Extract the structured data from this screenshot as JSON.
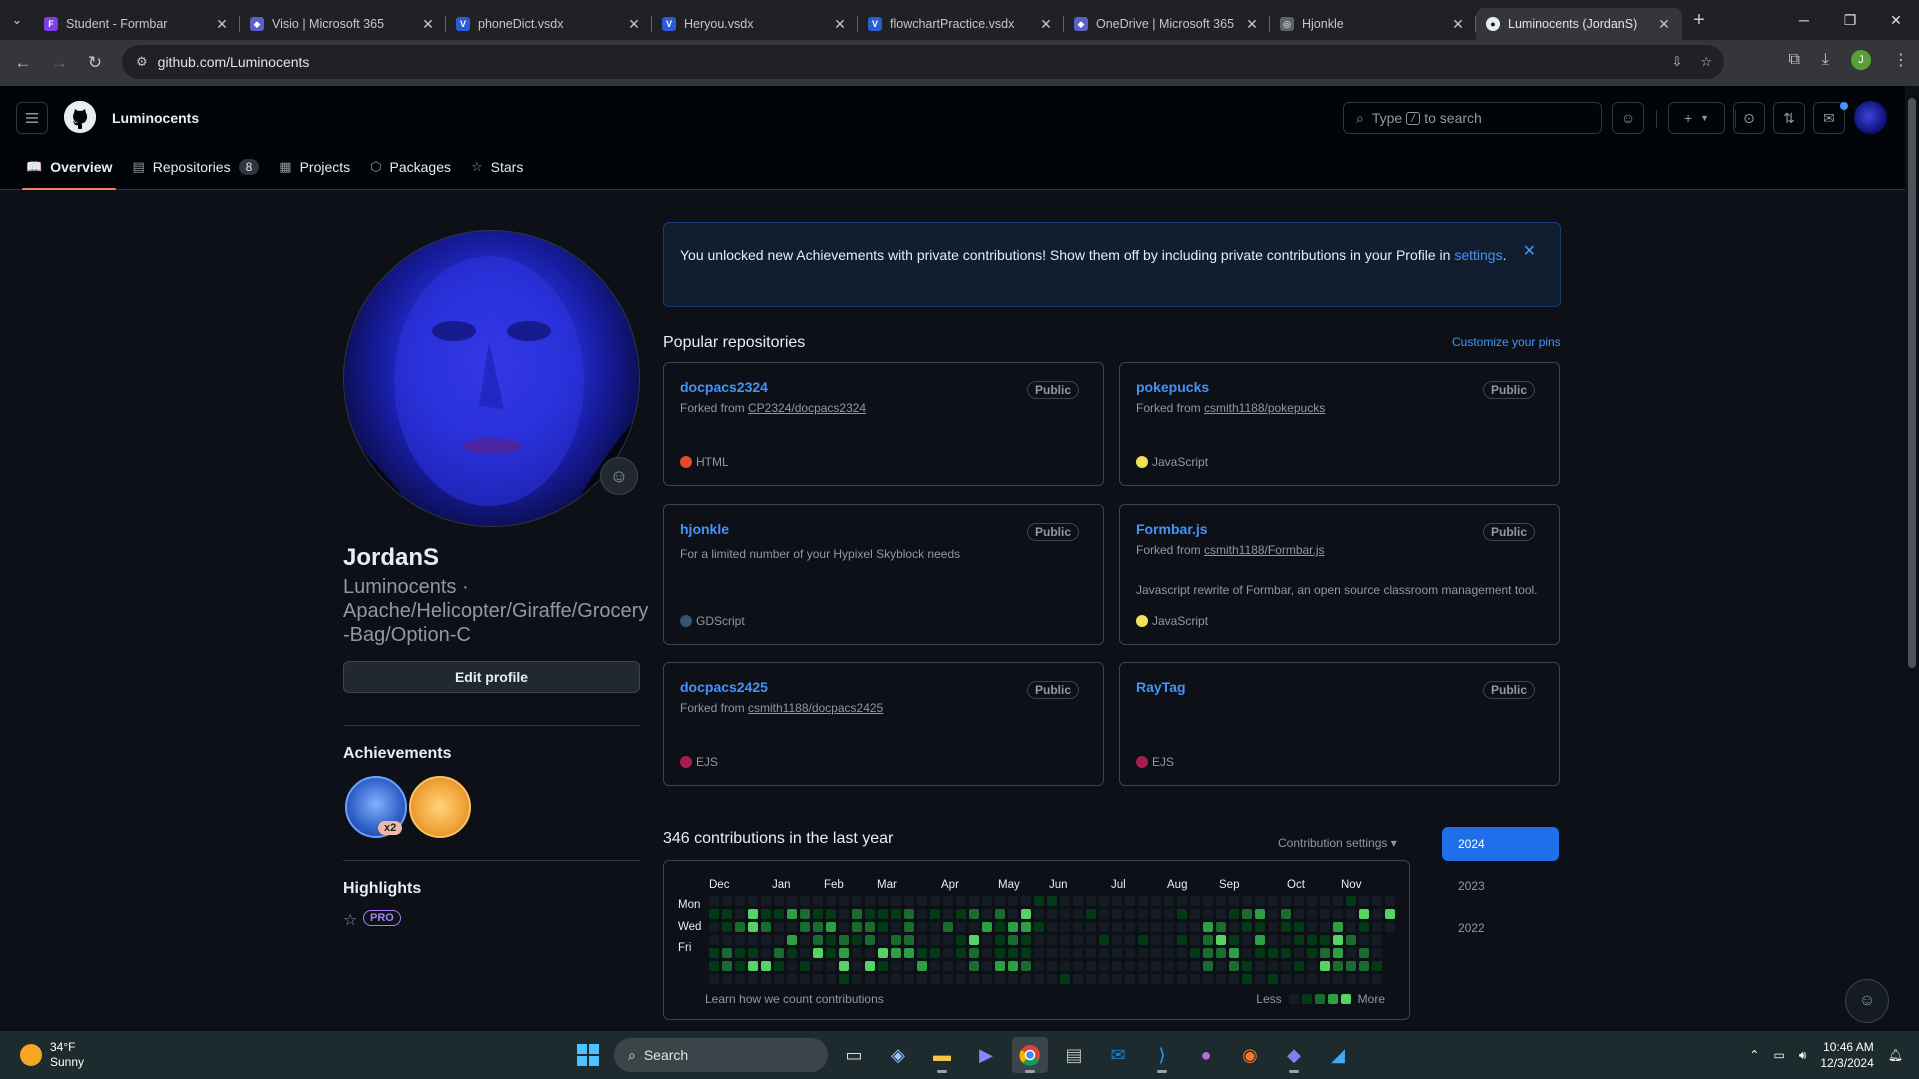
{
  "browser": {
    "tabs": [
      {
        "title": "Student - Formbar",
        "icon": "formbar-icon",
        "color": "#7b3fe4",
        "letter": "F"
      },
      {
        "title": "Visio | Microsoft 365",
        "icon": "m365-icon",
        "color": "#5b5fc7",
        "letter": "◆"
      },
      {
        "title": "phoneDict.vsdx",
        "icon": "visio-icon",
        "color": "#2b5cd8",
        "letter": "V"
      },
      {
        "title": "Heryou.vsdx",
        "icon": "visio-icon",
        "color": "#2b5cd8",
        "letter": "V"
      },
      {
        "title": "flowchartPractice.vsdx",
        "icon": "visio-icon",
        "color": "#2b5cd8",
        "letter": "V"
      },
      {
        "title": "OneDrive | Microsoft 365",
        "icon": "m365-icon",
        "color": "#5b5fc7",
        "letter": "◆"
      },
      {
        "title": "Hjonkle",
        "icon": "globe-icon",
        "color": "#5f6368",
        "letter": "◎"
      },
      {
        "title": "Luminocents (JordanS)",
        "icon": "github-icon",
        "color": "#e6edf3",
        "letter": "●",
        "active": true
      }
    ],
    "url": "github.com/Luminocents",
    "profile_letter": "J"
  },
  "header": {
    "username": "Luminocents",
    "search_prefix": "Type",
    "search_key": "/",
    "search_suffix": "to search"
  },
  "profile_nav": [
    {
      "label": "Overview",
      "icon": "book-icon",
      "glyph": "📖",
      "active": true
    },
    {
      "label": "Repositories",
      "icon": "repo-icon",
      "glyph": "▤",
      "count": "8"
    },
    {
      "label": "Projects",
      "icon": "table-icon",
      "glyph": "▦"
    },
    {
      "label": "Packages",
      "icon": "package-icon",
      "glyph": "⬡"
    },
    {
      "label": "Stars",
      "icon": "star-icon",
      "glyph": "☆"
    }
  ],
  "profile": {
    "name": "JordanS",
    "login_line1": "Luminocents ·",
    "login_line2": "Apache/Helicopter/Giraffe/Grocery",
    "login_line3": "-Bag/Option-C",
    "edit_label": "Edit profile",
    "achievements_title": "Achievements",
    "achievement_count": "x2",
    "highlights_title": "Highlights",
    "pro_label": "PRO"
  },
  "flash": {
    "text": "You unlocked new Achievements with private contributions! Show them off by including private contributions in your Profile in",
    "link": "settings",
    "end": "."
  },
  "popular": {
    "title": "Popular repositories",
    "customize": "Customize your pins",
    "repos": [
      {
        "name": "docpacs2324",
        "visibility": "Public",
        "forked_prefix": "Forked from ",
        "forked_from": "CP2324/docpacs2324",
        "description": "",
        "language": "HTML",
        "lang_color": "#e34c26"
      },
      {
        "name": "pokepucks",
        "visibility": "Public",
        "forked_prefix": "Forked from ",
        "forked_from": "csmith1188/pokepucks",
        "description": "",
        "language": "JavaScript",
        "lang_color": "#f1e05a"
      },
      {
        "name": "hjonkle",
        "visibility": "Public",
        "forked_prefix": "",
        "forked_from": "",
        "description": "For a limited number of your Hypixel Skyblock needs",
        "language": "GDScript",
        "lang_color": "#355570"
      },
      {
        "name": "Formbar.js",
        "visibility": "Public",
        "forked_prefix": "Forked from ",
        "forked_from": "csmith1188/Formbar.js",
        "description": "Javascript rewrite of Formbar, an open source classroom management tool.",
        "language": "JavaScript",
        "lang_color": "#f1e05a"
      },
      {
        "name": "docpacs2425",
        "visibility": "Public",
        "forked_prefix": "Forked from ",
        "forked_from": "csmith1188/docpacs2425",
        "description": "",
        "language": "EJS",
        "lang_color": "#a91e50"
      },
      {
        "name": "RayTag",
        "visibility": "Public",
        "forked_prefix": "",
        "forked_from": "",
        "description": "",
        "language": "EJS",
        "lang_color": "#a91e50"
      }
    ]
  },
  "contributions": {
    "title": "346 contributions in the last year",
    "settings_label": "Contribution settings ▾",
    "months": [
      "Dec",
      "Jan",
      "Feb",
      "Mar",
      "Apr",
      "May",
      "Jun",
      "Jul",
      "Aug",
      "Sep",
      "Oct",
      "Nov"
    ],
    "days": [
      "Mon",
      "Wed",
      "Fri"
    ],
    "learn": "Learn how we count contributions",
    "less": "Less",
    "more": "More",
    "years": [
      "2024",
      "2023",
      "2022"
    ],
    "selected_year": "2024",
    "level_colors": [
      "#151b23",
      "#033a16",
      "#196c2e",
      "#2ea043",
      "#56d364"
    ]
  },
  "taskbar": {
    "temp": "34°F",
    "condition": "Sunny",
    "weather_badge": "1",
    "search": "Search",
    "time": "10:46 AM",
    "date": "12/3/2024"
  }
}
